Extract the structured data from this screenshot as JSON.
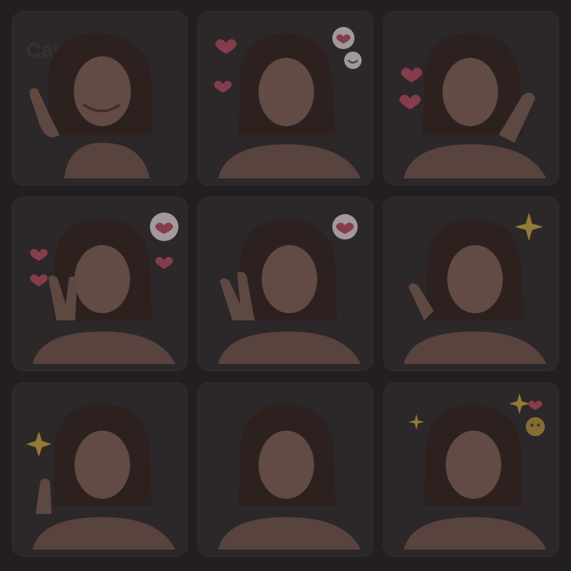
{
  "watermark": "CapCut",
  "tiles": [
    {
      "id": "1",
      "decor": [
        "hand-wave"
      ]
    },
    {
      "id": "2",
      "decor": [
        "heart",
        "heart",
        "heart-bubble",
        "smile-bubble"
      ]
    },
    {
      "id": "3",
      "decor": [
        "heart",
        "heart",
        "hand-cheek"
      ]
    },
    {
      "id": "4",
      "decor": [
        "heart",
        "heart",
        "heart",
        "heart-bubble",
        "peace-hand"
      ]
    },
    {
      "id": "5",
      "decor": [
        "heart-bubble",
        "hand-wave"
      ]
    },
    {
      "id": "6",
      "decor": [
        "sparkle",
        "hand-wave"
      ]
    },
    {
      "id": "7",
      "decor": [
        "sparkle",
        "hand-raise"
      ]
    },
    {
      "id": "8",
      "decor": []
    },
    {
      "id": "9",
      "decor": [
        "sparkle",
        "sparkle",
        "heart",
        "sweat-bubble"
      ]
    }
  ],
  "colors": {
    "background": "#2b2628",
    "tile": "#3a3436",
    "hair": "#3b2a27",
    "skin": "#8a6a60",
    "heart": "#c2546a",
    "sparkle": "#d8b24a"
  }
}
